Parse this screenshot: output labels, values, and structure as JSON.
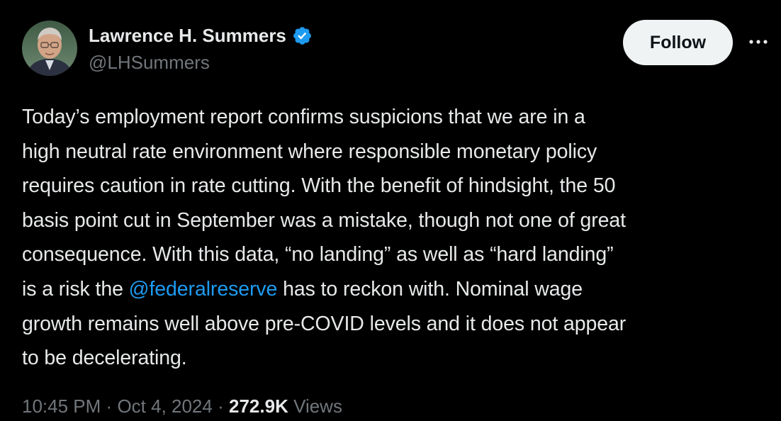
{
  "author": {
    "display_name": "Lawrence H. Summers",
    "handle": "@LHSummers",
    "verified": true
  },
  "actions": {
    "follow_label": "Follow",
    "more_icon": "more-horizontal-icon"
  },
  "tweet": {
    "text_parts": {
      "line1": "Today’s employment report confirms suspicions that we are in a",
      "line2": "high neutral rate environment where responsible monetary policy",
      "line3": "requires caution in rate cutting. With the benefit of hindsight, the 50",
      "line4": "basis point cut in September was a mistake, though not one of great",
      "line5": "consequence.  With this data, “no landing” as well as “hard landing”",
      "line6_before": "is a risk the ",
      "line6_mention": "@federalreserve",
      "line6_after": " has to reckon with.  Nominal wage",
      "line7": "growth remains well above pre-COVID levels and it does not appear",
      "line8": "to be decelerating."
    }
  },
  "meta": {
    "time": "10:45 PM",
    "separator": "·",
    "date": "Oct 4, 2024",
    "views_count": "272.9K",
    "views_label": "Views"
  },
  "colors": {
    "background": "#000000",
    "text": "#e7e9ea",
    "secondary_text": "#71767b",
    "link": "#1d9bf0",
    "verified_badge": "#1d9bf0",
    "follow_button_bg": "#eff3f4"
  }
}
